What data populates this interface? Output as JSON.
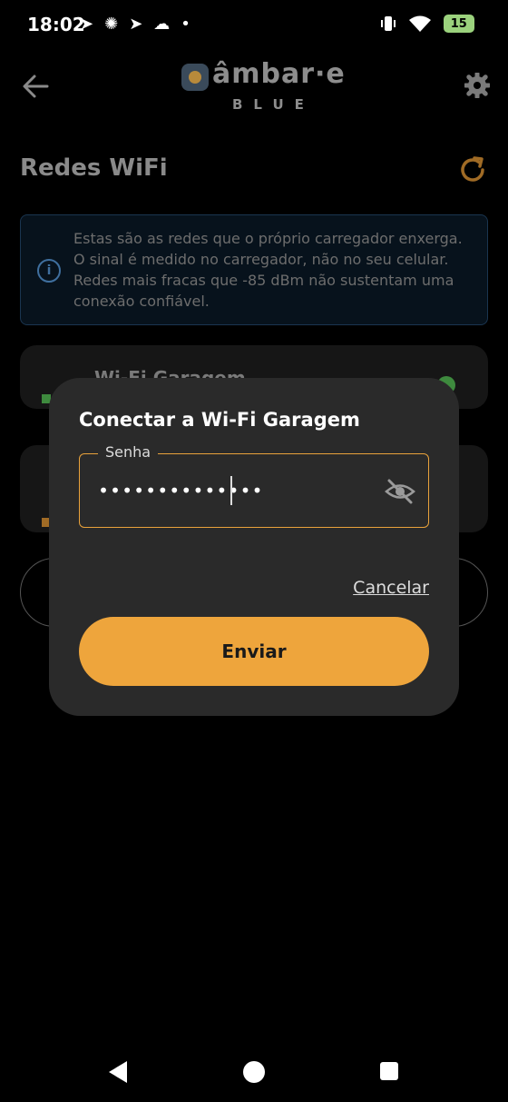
{
  "status_bar": {
    "time": "18:02",
    "battery_level": "15",
    "icons_left": [
      "navigation-icon",
      "asterisk-icon",
      "navigation-icon",
      "cloud-icon",
      "dot-icon"
    ],
    "icons_right": [
      "vibrate-icon",
      "wifi-icon",
      "battery-icon"
    ]
  },
  "header": {
    "logo_main": "âmbar·e",
    "logo_sub": "BLUE",
    "back_icon": "arrow-left-icon",
    "settings_icon": "gear-icon"
  },
  "page": {
    "title": "Redes WiFi",
    "refresh_icon": "refresh-icon",
    "info_text": "Estas são as redes que o próprio carregador enxerga. O sinal é medido no carregador, não no seu celular. Redes mais fracas que -85 dBm não sustentam uma conexão confiável.",
    "networks": [
      {
        "name": "Wi-Fi Garagem"
      },
      {
        "name": ""
      }
    ]
  },
  "dialog": {
    "title": "Conectar a Wi-Fi Garagem",
    "field_label": "Senha",
    "password_value": "••••••••••••••",
    "cancel_label": "Cancelar",
    "submit_label": "Enviar"
  },
  "colors": {
    "accent": "#eea53c",
    "dialog_bg": "#2a2a2a",
    "info_border": "#1a3550"
  }
}
